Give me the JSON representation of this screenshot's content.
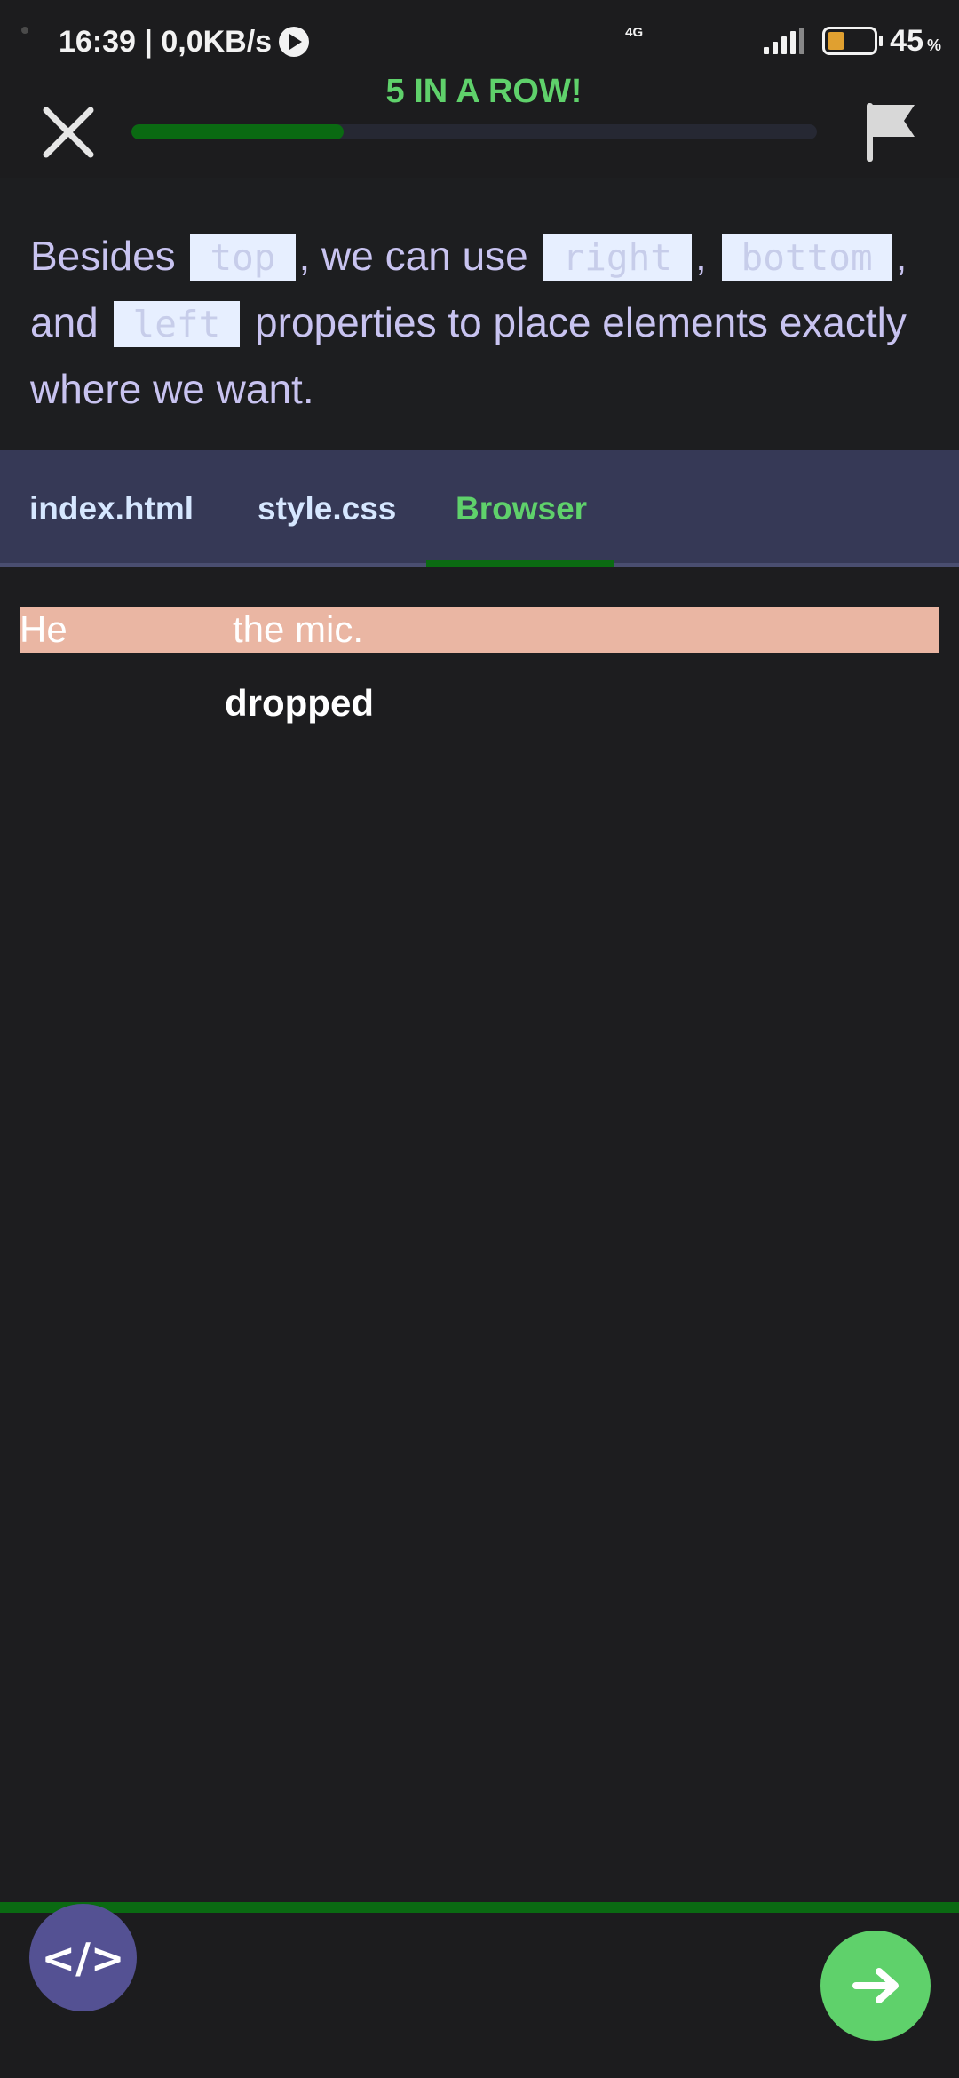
{
  "status_bar": {
    "time_speed": "16:39 | 0,0KB/s",
    "network_type": "4G",
    "battery_percent": "45",
    "battery_unit": "%",
    "battery_level": 0.45
  },
  "header": {
    "streak_text": "5 IN A ROW!",
    "progress": 0.31,
    "progress_color": "#0a6a12",
    "close_icon": "close-icon",
    "flag_icon": "flag-icon"
  },
  "instruction": {
    "part1": "Besides ",
    "code1": "top",
    "part2": ", we can use ",
    "code2": "right",
    "part3": ", ",
    "code3": "bottom",
    "part4": ", and ",
    "code4": "left",
    "part5": " properties to place elements exactly where we want."
  },
  "tabs": {
    "items": [
      {
        "label": "index.html"
      },
      {
        "label": "style.css"
      },
      {
        "label": "Browser"
      }
    ],
    "active": "Browser",
    "active_color": "#5fd16b"
  },
  "preview": {
    "word_he": "He",
    "word_the_mic": "the mic.",
    "word_dropped": "dropped",
    "bar_color": "#eab6a3"
  },
  "footer": {
    "code_button_label": "</>",
    "next_icon": "arrow-right-icon",
    "accent": "#5fd16b"
  }
}
